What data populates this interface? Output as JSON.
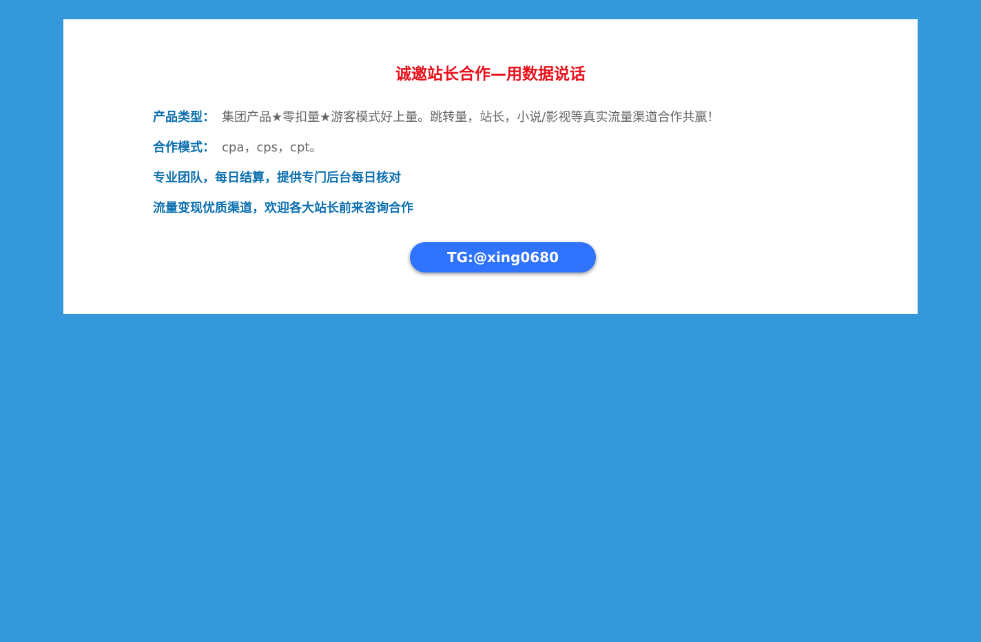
{
  "page": {
    "background_color": "#3498db",
    "card_color": "#ffffff"
  },
  "header": {
    "title": "诚邀站长合作—用数据说话",
    "title_color": "#e8101a"
  },
  "info": {
    "product_type_label": "产品类型：",
    "product_type_value": "集团产品★零扣量★游客模式好上量。跳转量，站长，小说/影视等真实流量渠道合作共赢！",
    "coop_mode_label": "合作模式：",
    "coop_mode_value": "cpa，cps，cpt。",
    "line_team": "专业团队，每日结算，提供专门后台每日核对",
    "line_channel": "流量变现优质渠道，欢迎各大站长前来咨询合作",
    "accent_color": "#0b6fb0"
  },
  "cta": {
    "label": "TG:@xing0680",
    "color": "#2f73ff"
  }
}
